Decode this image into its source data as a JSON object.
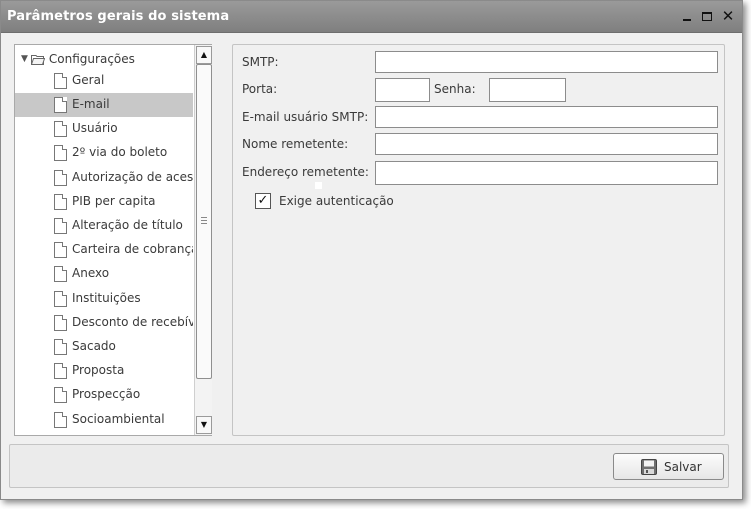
{
  "window": {
    "title": "Parâmetros gerais do sistema"
  },
  "tree": {
    "root_label": "Configurações",
    "items": [
      {
        "label": "Geral",
        "selected": false
      },
      {
        "label": "E-mail",
        "selected": true
      },
      {
        "label": "Usuário",
        "selected": false
      },
      {
        "label": "2º via do boleto",
        "selected": false
      },
      {
        "label": "Autorização de acesso",
        "selected": false
      },
      {
        "label": "PIB per capita",
        "selected": false
      },
      {
        "label": "Alteração de título",
        "selected": false
      },
      {
        "label": "Carteira de cobrança",
        "selected": false
      },
      {
        "label": "Anexo",
        "selected": false
      },
      {
        "label": "Instituições",
        "selected": false
      },
      {
        "label": "Desconto de recebíveis",
        "selected": false
      },
      {
        "label": "Sacado",
        "selected": false
      },
      {
        "label": "Proposta",
        "selected": false
      },
      {
        "label": "Prospecção",
        "selected": false
      },
      {
        "label": "Socioambiental",
        "selected": false
      }
    ]
  },
  "form": {
    "smtp_label": "SMTP:",
    "smtp_value": "",
    "porta_label": "Porta:",
    "porta_value": "",
    "senha_label": "Senha:",
    "senha_value": "",
    "email_usuario_label": "E-mail usuário SMTP:",
    "email_usuario_value": "",
    "nome_remetente_label": "Nome remetente:",
    "nome_remetente_value": "",
    "endereco_remetente_label": "Endereço remetente:",
    "endereco_remetente_value": "",
    "exige_autenticacao_label": "Exige autenticação",
    "exige_autenticacao_checked": true
  },
  "footer": {
    "save_label": "Salvar"
  },
  "icons": {
    "minimize": "minimize-icon",
    "maximize": "maximize-icon",
    "close": "close-icon",
    "folder": "folder-open-icon",
    "document": "document-icon",
    "save": "floppy-disk-icon"
  },
  "colors": {
    "titlebar": "#8c8c8c",
    "selected_item": "#c8c8c8",
    "window_bg": "#f0f0f0"
  }
}
